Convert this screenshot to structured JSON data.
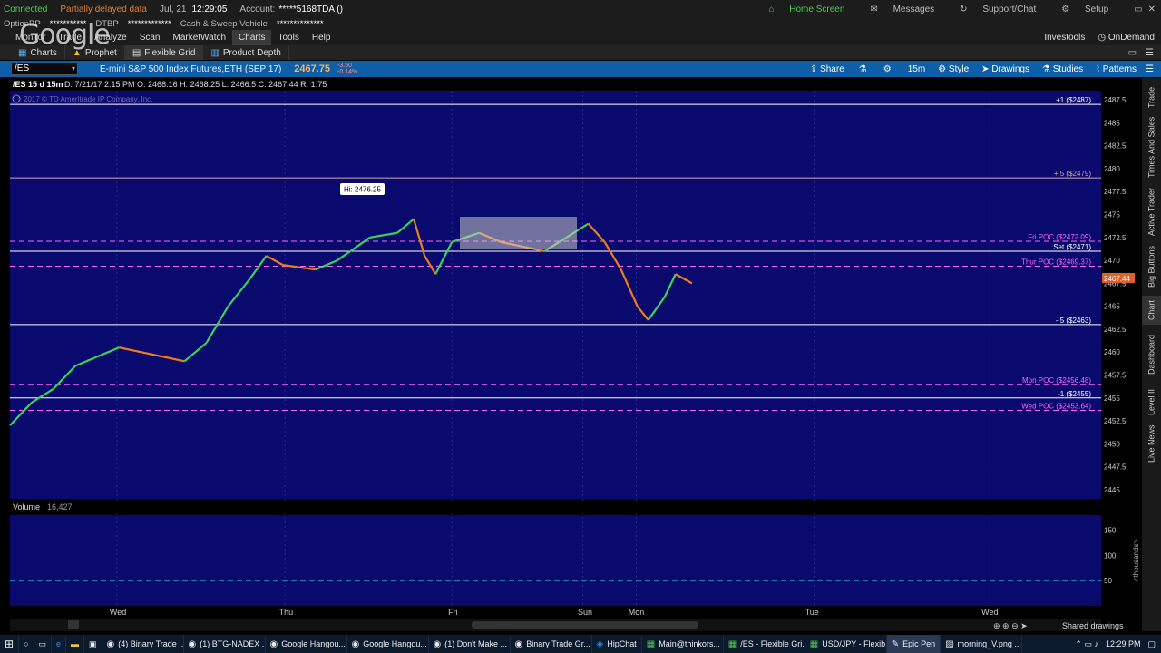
{
  "status_bar": {
    "connected": "Connected",
    "delayed": "Partially delayed data",
    "date": "Jul, 21",
    "time": "12:29:05",
    "account_label": "Account:",
    "account": "*****5168TDA ()",
    "right_items": [
      {
        "icon": "home-icon",
        "label": "Home Screen"
      },
      {
        "icon": "mail-icon",
        "label": "Messages"
      },
      {
        "icon": "support-icon",
        "label": "Support/Chat"
      },
      {
        "icon": "gear-icon",
        "label": "Setup"
      }
    ]
  },
  "account_bar": {
    "items": [
      "OptionBP",
      "***********",
      "DTBP",
      "*************",
      "Cash & Sweep Vehicle",
      "**************"
    ]
  },
  "menu": {
    "items": [
      "Monitor",
      "Trade",
      "Analyze",
      "Scan",
      "MarketWatch",
      "Charts",
      "Tools",
      "Help"
    ],
    "active": "Charts",
    "right": [
      "Investools",
      "OnDemand"
    ]
  },
  "tabs": {
    "items": [
      "Charts",
      "Prophet",
      "Flexible Grid",
      "Product Depth"
    ]
  },
  "toolbar": {
    "symbol": "/ES",
    "description": "E-mini S&P 500 Index Futures,ETH (SEP 17)",
    "price": "2467.75",
    "change": "-3.50",
    "change_pct": "-0.14%",
    "right": [
      "Share",
      "15m",
      "Style",
      "Drawings",
      "Studies",
      "Patterns"
    ]
  },
  "chart_header": {
    "title": "/ES 15 d 15m",
    "info": "D: 7/21/17 2:15 PM   O: 2468.16   H: 2468.25   L: 2466.5   C: 2467.44   R: 1.75",
    "copyright": "2017 © TD Ameritrade IP Company, Inc.",
    "volume_label": "Volume",
    "volume_value": "16,427",
    "volume_units": "<thousands>"
  },
  "chart_data": {
    "type": "line",
    "title": "/ES 15 d 15m",
    "y_ticks": [
      2487.5,
      2485,
      2482.5,
      2480,
      2477.5,
      2475,
      2472.5,
      2470,
      2467.5,
      2465,
      2462.5,
      2460,
      2457.5,
      2455,
      2452.5,
      2450,
      2447.5,
      2445
    ],
    "ylim": [
      2444,
      2488.5
    ],
    "x_labels": [
      "Wed",
      "Thu",
      "Fri",
      "Sun",
      "Mon",
      "Tue",
      "Wed"
    ],
    "last_price": "2467.44",
    "high_label": "Hi: 2476.25",
    "levels": [
      {
        "label": "+1 ($2487)",
        "value": 2487,
        "color": "#ffffff",
        "dash": false
      },
      {
        "label": "+.5 ($2479)",
        "value": 2479,
        "color": "#d9a6a6",
        "dash": false
      },
      {
        "label": "Fri POC ($2472.09)",
        "value": 2472.09,
        "color": "#ff66ff",
        "dash": true
      },
      {
        "label": "Set ($2471)",
        "value": 2471,
        "color": "#ffffff",
        "dash": false
      },
      {
        "label": "Thur POC ($2469.37)",
        "value": 2469.37,
        "color": "#ff66ff",
        "dash": true
      },
      {
        "label": "-.5 ($2463)",
        "value": 2463,
        "color": "#ffffff",
        "dash": false
      },
      {
        "label": "Mon POC ($2456.48)",
        "value": 2456.48,
        "color": "#ff66ff",
        "dash": true
      },
      {
        "label": "-1 ($2455)",
        "value": 2455,
        "color": "#ffffff",
        "dash": false
      },
      {
        "label": "Wed POC ($2453.64)",
        "value": 2453.64,
        "color": "#ff66ff",
        "dash": true
      }
    ],
    "price_series": [
      {
        "t": 0.0,
        "v": 2452
      },
      {
        "t": 0.02,
        "v": 2454.5
      },
      {
        "t": 0.04,
        "v": 2456
      },
      {
        "t": 0.06,
        "v": 2458.5
      },
      {
        "t": 0.08,
        "v": 2459.5
      },
      {
        "t": 0.1,
        "v": 2460.5
      },
      {
        "t": 0.12,
        "v": 2460
      },
      {
        "t": 0.14,
        "v": 2459.5
      },
      {
        "t": 0.16,
        "v": 2459
      },
      {
        "t": 0.18,
        "v": 2461
      },
      {
        "t": 0.2,
        "v": 2465
      },
      {
        "t": 0.22,
        "v": 2468
      },
      {
        "t": 0.235,
        "v": 2470.5
      },
      {
        "t": 0.25,
        "v": 2469.5
      },
      {
        "t": 0.28,
        "v": 2469
      },
      {
        "t": 0.3,
        "v": 2470
      },
      {
        "t": 0.33,
        "v": 2472.5
      },
      {
        "t": 0.355,
        "v": 2473
      },
      {
        "t": 0.37,
        "v": 2474.5
      },
      {
        "t": 0.38,
        "v": 2470.5
      },
      {
        "t": 0.39,
        "v": 2468.5
      },
      {
        "t": 0.405,
        "v": 2472
      },
      {
        "t": 0.43,
        "v": 2473
      },
      {
        "t": 0.45,
        "v": 2472
      },
      {
        "t": 0.47,
        "v": 2471.5
      },
      {
        "t": 0.49,
        "v": 2471
      },
      {
        "t": 0.51,
        "v": 2472.5
      },
      {
        "t": 0.53,
        "v": 2474
      },
      {
        "t": 0.545,
        "v": 2472
      },
      {
        "t": 0.56,
        "v": 2469
      },
      {
        "t": 0.575,
        "v": 2465
      },
      {
        "t": 0.585,
        "v": 2463.5
      },
      {
        "t": 0.6,
        "v": 2466
      },
      {
        "t": 0.61,
        "v": 2468.5
      },
      {
        "t": 0.625,
        "v": 2467.5
      }
    ],
    "volume_ticks": [
      150,
      100,
      50
    ]
  },
  "footer": {
    "shared_drawings": "Shared drawings"
  },
  "right_tabs": [
    "Trade",
    "Times And Sales",
    "Active Trader",
    "Big Buttons",
    "Chart",
    "Dashboard",
    "Level II",
    "Live News"
  ],
  "taskbar": {
    "items": [
      "(4) Binary Trade ...",
      "(1) BTG-NADEX ...",
      "Google Hangou...",
      "Google Hangou...",
      "(1) Don't Make ...",
      "Binary Trade Gr...",
      "HipChat",
      "Main@thinkors...",
      "/ES - Flexible Gri...",
      "USD/JPY - Flexib...",
      "Epic Pen",
      "morning_V.png ..."
    ],
    "clock": "12:29 PM"
  },
  "watermark": "Google"
}
